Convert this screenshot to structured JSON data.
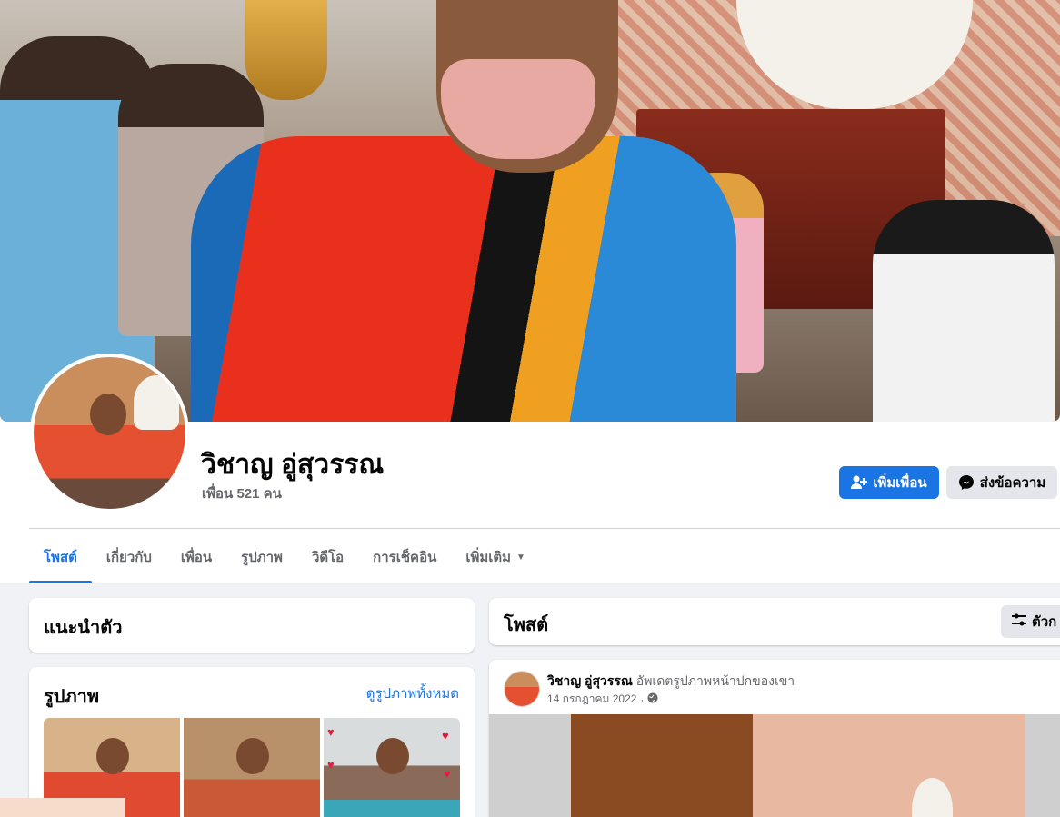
{
  "profile": {
    "name": "วิชาญ อู่สุวรรณ",
    "friends": "เพื่อน 521 คน"
  },
  "actions": {
    "add_friend": "เพิ่มเพื่อน",
    "message": "ส่งข้อความ"
  },
  "tabs": [
    {
      "label": "โพสต์",
      "active": true
    },
    {
      "label": "เกี่ยวกับ",
      "active": false
    },
    {
      "label": "เพื่อน",
      "active": false
    },
    {
      "label": "รูปภาพ",
      "active": false
    },
    {
      "label": "วิดีโอ",
      "active": false
    },
    {
      "label": "การเช็คอิน",
      "active": false
    },
    {
      "label": "เพิ่มเติม",
      "active": false
    }
  ],
  "intro": {
    "title": "แนะนำตัว"
  },
  "photos": {
    "title": "รูปภาพ",
    "see_all": "ดูรูปภาพทั้งหมด"
  },
  "posts": {
    "title": "โพสต์",
    "filter_label": "ตัวก"
  },
  "post": {
    "author": "วิชาญ อู่สุวรรณ",
    "action": "อัพเดตรูปภาพหน้าปกของเขา",
    "date": "14 กรกฎาคม 2022",
    "separator": "·"
  },
  "colors": {
    "accent": "#1b74e4",
    "page_bg": "#f0f2f5",
    "secondary_text": "#65676b"
  }
}
